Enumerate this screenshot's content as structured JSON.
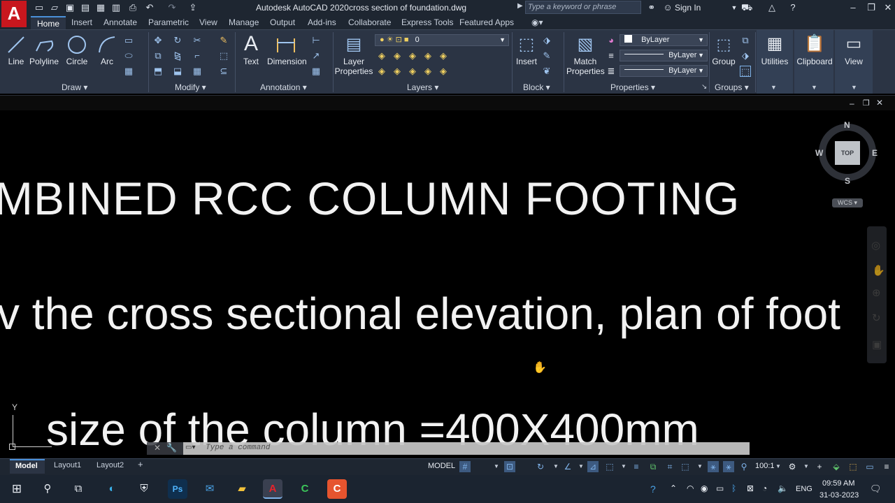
{
  "titlebar": {
    "app_title": "Autodesk AutoCAD 2020",
    "file_title": "cross section of foundation.dwg",
    "search_placeholder": "Type a keyword or phrase",
    "sign_in": "Sign In"
  },
  "tabs": [
    "Home",
    "Insert",
    "Annotate",
    "Parametric",
    "View",
    "Manage",
    "Output",
    "Add-ins",
    "Collaborate",
    "Express Tools",
    "Featured Apps"
  ],
  "ribbon": {
    "draw": {
      "label": "Draw",
      "buttons": [
        "Line",
        "Polyline",
        "Circle",
        "Arc"
      ]
    },
    "modify": {
      "label": "Modify"
    },
    "annotation": {
      "label": "Annotation",
      "buttons": [
        "Text",
        "Dimension"
      ]
    },
    "layers": {
      "label": "Layers",
      "button_line1": "Layer",
      "button_line2": "Properties",
      "current_layer": "0"
    },
    "block": {
      "label": "Block",
      "button": "Insert"
    },
    "properties": {
      "label": "Properties",
      "button_line1": "Match",
      "button_line2": "Properties",
      "color": "ByLayer",
      "linetype": "ByLayer",
      "lineweight": "ByLayer"
    },
    "groups": {
      "label": "Groups",
      "button": "Group"
    },
    "utilities": {
      "button": "Utilities"
    },
    "clipboard": {
      "button": "Clipboard"
    },
    "view": {
      "button": "View"
    }
  },
  "drawing": {
    "line1": "MBINED RCC COLUMN FOOTING",
    "line2": "v the cross sectional elevation, plan of foot",
    "line3": "size of the column =400X400mm"
  },
  "viewcube": {
    "north": "N",
    "south": "S",
    "east": "E",
    "west": "W",
    "face": "TOP",
    "ucs": "WCS"
  },
  "ucs_icon": {
    "y": "Y"
  },
  "command": {
    "placeholder": "Type a command"
  },
  "layout_tabs": [
    "Model",
    "Layout1",
    "Layout2"
  ],
  "status": {
    "model": "MODEL",
    "scale": "100:1"
  },
  "taskbar": {
    "time": "09:59 AM",
    "date": "31-03-2023",
    "lang": "ENG"
  },
  "colors": {
    "accent": "#4a90d9",
    "ribbon_bg": "#2b3444",
    "titlebar_bg": "#1e2631"
  }
}
